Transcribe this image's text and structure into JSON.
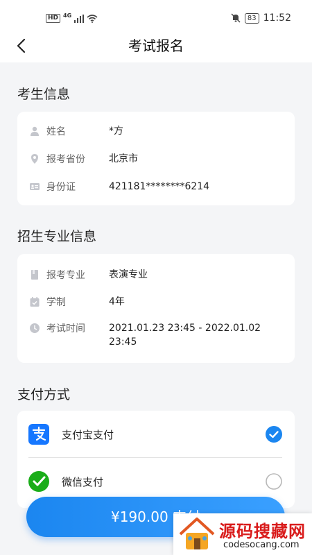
{
  "status": {
    "hd": "HD",
    "network": "4G",
    "battery": "83",
    "time": "11:52"
  },
  "nav": {
    "title": "考试报名",
    "back_icon": "chevron-left-icon"
  },
  "candidate": {
    "section_title": "考生信息",
    "rows": [
      {
        "icon": "user-icon",
        "label": "姓名",
        "value": "*方"
      },
      {
        "icon": "location-pin-icon",
        "label": "报考省份",
        "value": "北京市"
      },
      {
        "icon": "id-card-icon",
        "label": "身份证",
        "value": "421181********6214"
      }
    ]
  },
  "major": {
    "section_title": "招生专业信息",
    "rows": [
      {
        "icon": "book-icon",
        "label": "报考专业",
        "value": "表演专业"
      },
      {
        "icon": "calendar-check-icon",
        "label": "学制",
        "value": "4年"
      },
      {
        "icon": "clock-icon",
        "label": "考试时间",
        "value": "2021.01.23 23:45 - 2022.01.02 23:45"
      }
    ]
  },
  "payment": {
    "section_title": "支付方式",
    "options": [
      {
        "icon": "alipay-icon",
        "label": "支付宝支付",
        "selected": true
      },
      {
        "icon": "wechat-pay-icon",
        "label": "微信支付",
        "selected": false
      }
    ],
    "button_label": "¥190.00 支付"
  },
  "watermark": {
    "title": "源码搜藏网",
    "subtitle": "codesocang.com"
  },
  "colors": {
    "accent": "#1b86f0",
    "alipay": "#1677ff",
    "wechat": "#1aad19",
    "watermark_red": "#d91c1c"
  }
}
